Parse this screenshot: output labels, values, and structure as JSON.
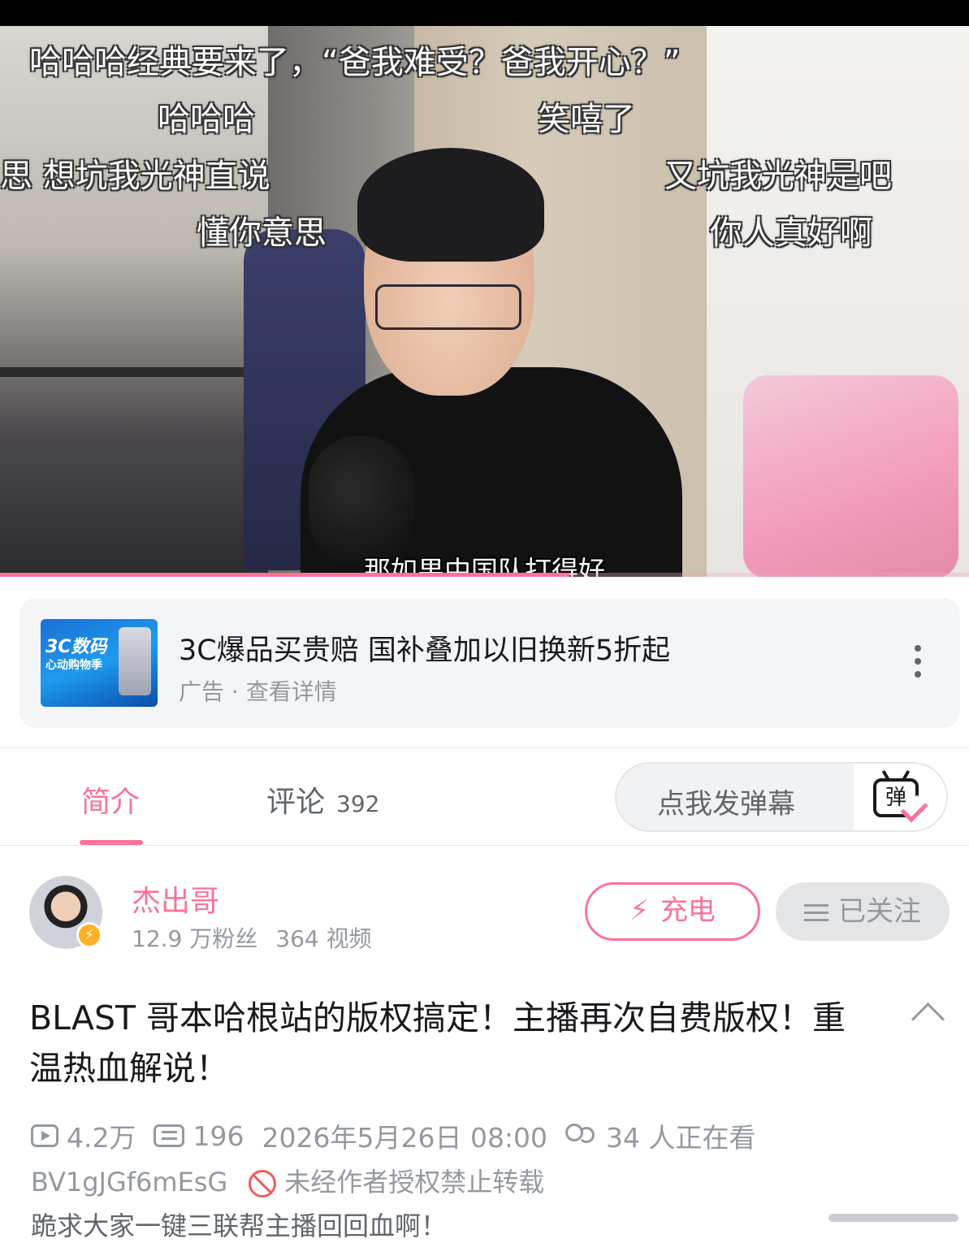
{
  "video": {
    "danmaku": [
      "哈哈哈经典要来了，“爸我难受？爸我开心？”",
      "哈哈哈",
      "笑嘻了",
      "思 想坑我光神直说",
      "又坑我光神是吧",
      "懂你意思",
      "你人真好啊"
    ],
    "subtitle": "那如果中国队打得好",
    "progress_percent": 58.8
  },
  "ad": {
    "thumb_text_1": "3C数码",
    "thumb_text_2": "心动购物季",
    "title": "3C爆品买贵赔 国补叠加以旧换新5折起",
    "subtitle": "广告 · 查看详情"
  },
  "tabs": {
    "intro": "简介",
    "comments": "评论",
    "comments_count": "392",
    "danmaku_placeholder": "点我发弹幕",
    "danmaku_button": "弹"
  },
  "uploader": {
    "name": "杰出哥",
    "fans": "12.9 万粉丝",
    "videos": "364 视频",
    "charge_label": "充电",
    "follow_label": "已关注"
  },
  "detail": {
    "title": "BLAST 哥本哈根站的版权搞定！主播再次自费版权！重温热血解说！",
    "views": "4.2万",
    "danmaku_count": "196",
    "publish_time": "2026年5月26日 08:00",
    "watching": "34 人正在看",
    "bvid": "BV1gJGf6mEsG",
    "copyright": "未经作者授权禁止转载",
    "description": "跪求大家一键三联帮主播回回血啊！"
  },
  "colors": {
    "accent": "#fb7299",
    "muted": "#9499a0",
    "text": "#18191c"
  }
}
